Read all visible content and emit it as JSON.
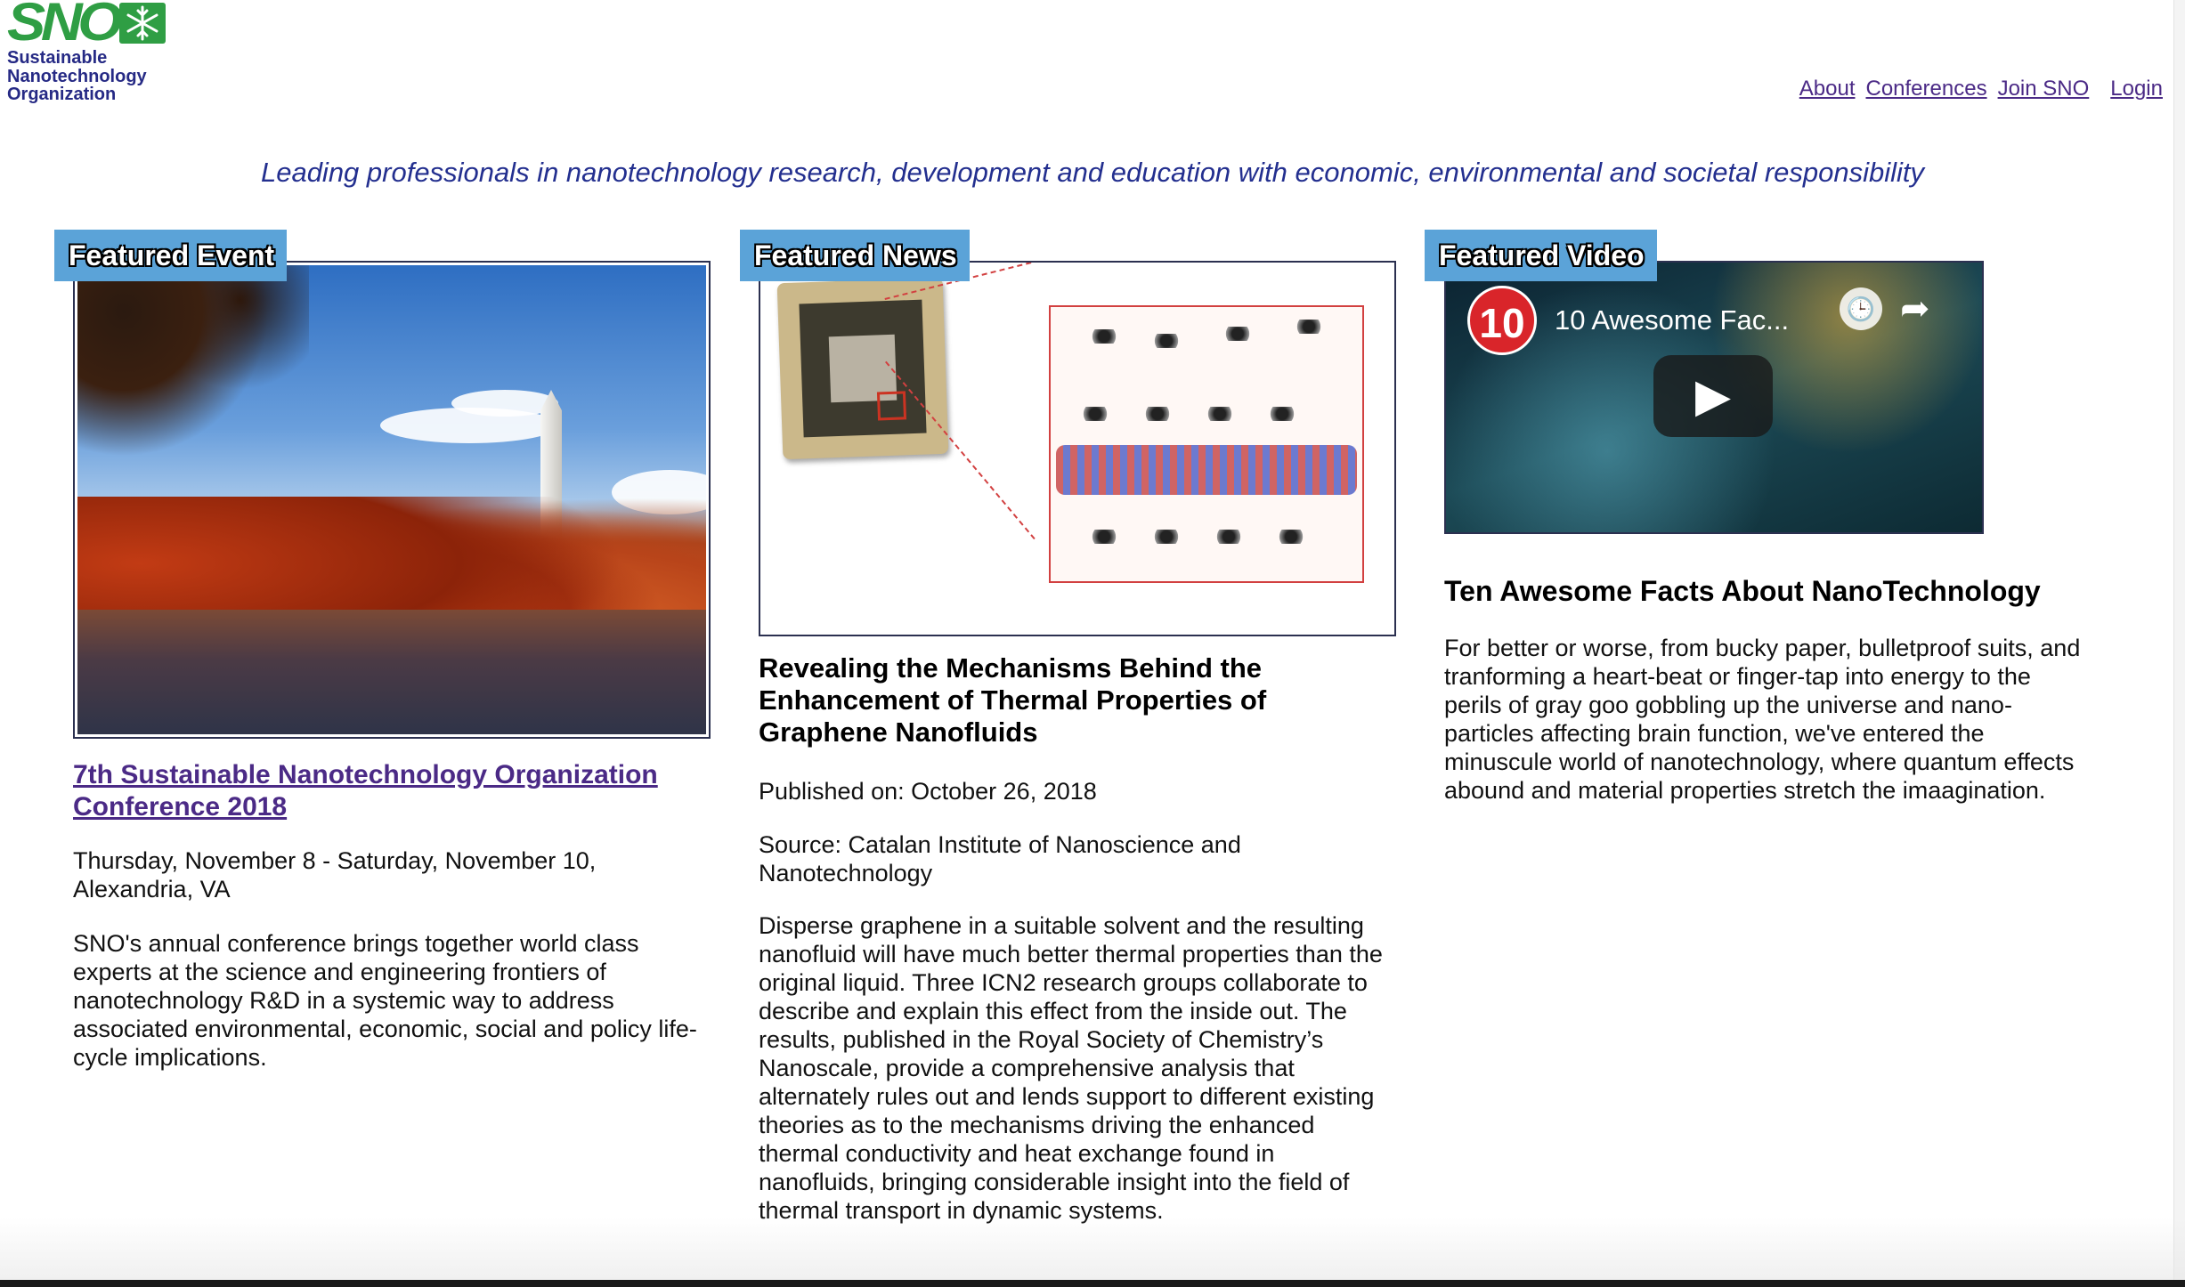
{
  "logo": {
    "alt": "SNO",
    "lines": [
      "Sustainable",
      "Nanotechnology",
      "Organization"
    ]
  },
  "nav": [
    {
      "label": "About"
    },
    {
      "label": "Conferences"
    },
    {
      "label": "Join SNO"
    },
    {
      "label": "Login"
    }
  ],
  "tagline": "Leading professionals in nanotechnology research, development and education with economic, environmental and societal responsibility",
  "event": {
    "label": "Featured Event",
    "title": "7th Sustainable Nanotechnology Organization Conference 2018",
    "date": "Thursday, November 8 - Saturday, November 10, Alexandria, VA",
    "description": "SNO's annual conference brings together world class experts at the science and engineering frontiers of nanotechnology R&D in a systemic way to address associated environmental, economic, social and policy life-cycle implications."
  },
  "news": {
    "label": "Featured News",
    "title": "Revealing the Mechanisms Behind the Enhancement of Thermal Properties of Graphene Nanofluids",
    "published": "Published on: October 26, 2018",
    "source": "Source: Catalan Institute of Nanoscience and Nanotechnology",
    "body": "Disperse graphene in a suitable solvent and the resulting nanofluid will have much better thermal properties than the original liquid. Three ICN2 research groups collaborate to describe and explain this effect from the inside out. The results, published in the Royal Society of Chemistry’s Nanoscale, provide a comprehensive analysis that alternately rules out and lends support to different existing theories as to the mechanisms driving the enhanced thermal conductivity and heat exchange found in nanofluids, bringing considerable insight into the field of thermal transport in dynamic systems."
  },
  "video": {
    "label": "Featured Video",
    "channel_badge": "10",
    "player_title": "10 Awesome Fac...",
    "heading": "Ten Awesome Facts About NanoTechnology",
    "description": "For better or worse, from bucky paper, bulletproof suits, and tranforming a heart-beat or finger-tap into energy to the perils of gray goo gobbling up the universe and nano-particles affecting brain function, we've entered the minuscule world of nanotechnology, where quantum effects abound and material properties stretch the imaagination."
  },
  "icons": {
    "play": "play-icon",
    "clock": "watch-later-icon",
    "share": "share-icon",
    "snowflake": "snowflake-icon"
  },
  "colors": {
    "brand_green": "#2f9e44",
    "brand_navy": "#262a85",
    "label_blue": "#5ba3d8",
    "link_purple": "#4b2a86",
    "youtube_red": "#d9252a"
  }
}
